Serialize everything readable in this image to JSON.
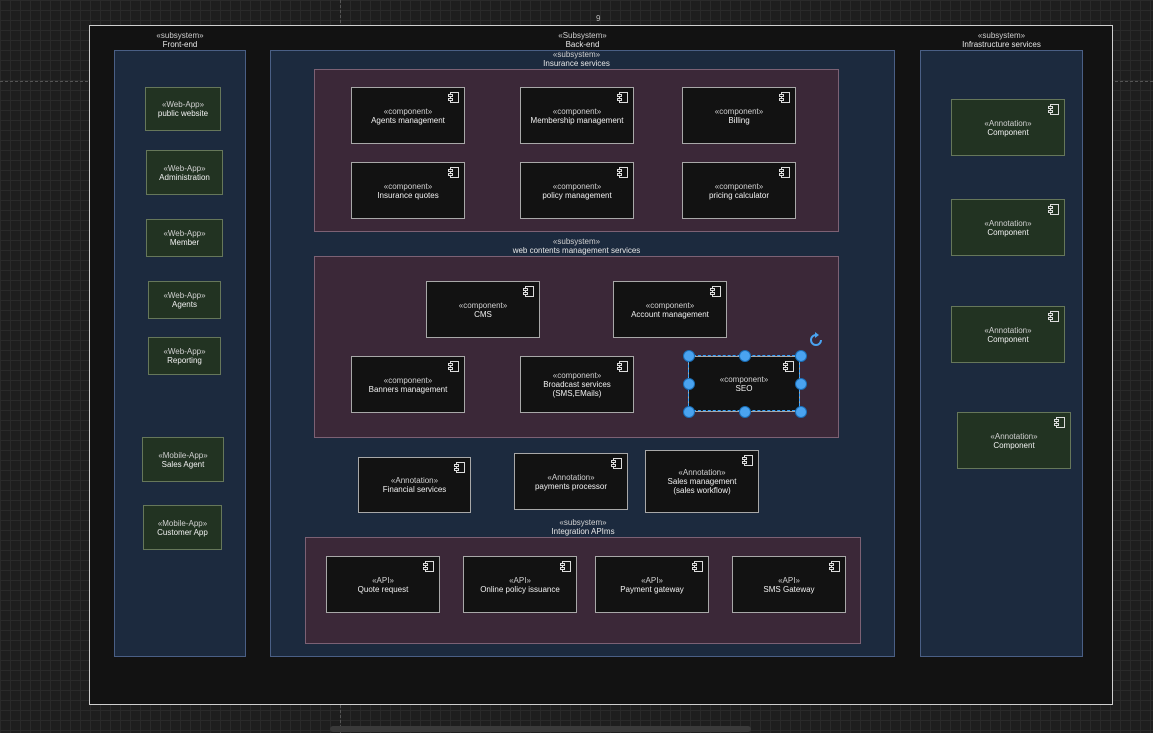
{
  "page_number": "9",
  "front_end": {
    "stereotype": "«subsystem»",
    "name": "Front-end",
    "apps": [
      {
        "stereotype": "«Web-App»",
        "name": "public website"
      },
      {
        "stereotype": "«Web-App»",
        "name": "Administration"
      },
      {
        "stereotype": "«Web-App»",
        "name": "Member"
      },
      {
        "stereotype": "«Web-App»",
        "name": "Agents"
      },
      {
        "stereotype": "«Web-App»",
        "name": "Reporting"
      },
      {
        "stereotype": "«Mobile-App»",
        "name": "Sales Agent"
      },
      {
        "stereotype": "«Mobile-App»",
        "name": "Customer App"
      }
    ]
  },
  "back_end": {
    "stereotype": "«Subsystem»",
    "name": "Back-end",
    "insurance": {
      "stereotype": "«subsystem»",
      "name": "Insurance services",
      "components": [
        {
          "stereotype": "«component»",
          "name": "Agents management"
        },
        {
          "stereotype": "«component»",
          "name": "Membership management"
        },
        {
          "stereotype": "«component»",
          "name": "Billing"
        },
        {
          "stereotype": "«component»",
          "name": "Insurance quotes"
        },
        {
          "stereotype": "«component»",
          "name": "policy management"
        },
        {
          "stereotype": "«component»",
          "name": "pricing calculator"
        }
      ]
    },
    "web_contents": {
      "stereotype": "«subsystem»",
      "name": "web contents management services",
      "components": [
        {
          "stereotype": "«component»",
          "name": "CMS"
        },
        {
          "stereotype": "«component»",
          "name": "Account management"
        },
        {
          "stereotype": "«component»",
          "name": "Banners management"
        },
        {
          "stereotype": "«component»",
          "name": "Broadcast services",
          "name2": "(SMS,EMails)"
        },
        {
          "stereotype": "«component»",
          "name": "SEO"
        }
      ]
    },
    "annotations": [
      {
        "stereotype": "«Annotation»",
        "name": "Financial services"
      },
      {
        "stereotype": "«Annotation»",
        "name": "payments processor"
      },
      {
        "stereotype": "«Annotation»",
        "name": "Sales management",
        "name2": "(sales workflow)"
      }
    ],
    "integration": {
      "stereotype": "«subsystem»",
      "name": "Integration APIms",
      "apis": [
        {
          "stereotype": "«API»",
          "name": "Quote request"
        },
        {
          "stereotype": "«API»",
          "name": "Online policy issuance"
        },
        {
          "stereotype": "«API»",
          "name": "Payment gateway"
        },
        {
          "stereotype": "«API»",
          "name": "SMS Gateway"
        }
      ]
    }
  },
  "infrastructure": {
    "stereotype": "«subsystem»",
    "name": "Infrastructure services",
    "components": [
      {
        "stereotype": "«Annotation»",
        "name": "Component"
      },
      {
        "stereotype": "«Annotation»",
        "name": "Component"
      },
      {
        "stereotype": "«Annotation»",
        "name": "Component"
      },
      {
        "stereotype": "«Annotation»",
        "name": "Component"
      }
    ]
  },
  "colors": {
    "subsystem_fill": "#1c2a3e",
    "inner_subsystem_fill": "#3b2838",
    "webapp_fill": "#223322",
    "selection": "#4aa3f0"
  }
}
